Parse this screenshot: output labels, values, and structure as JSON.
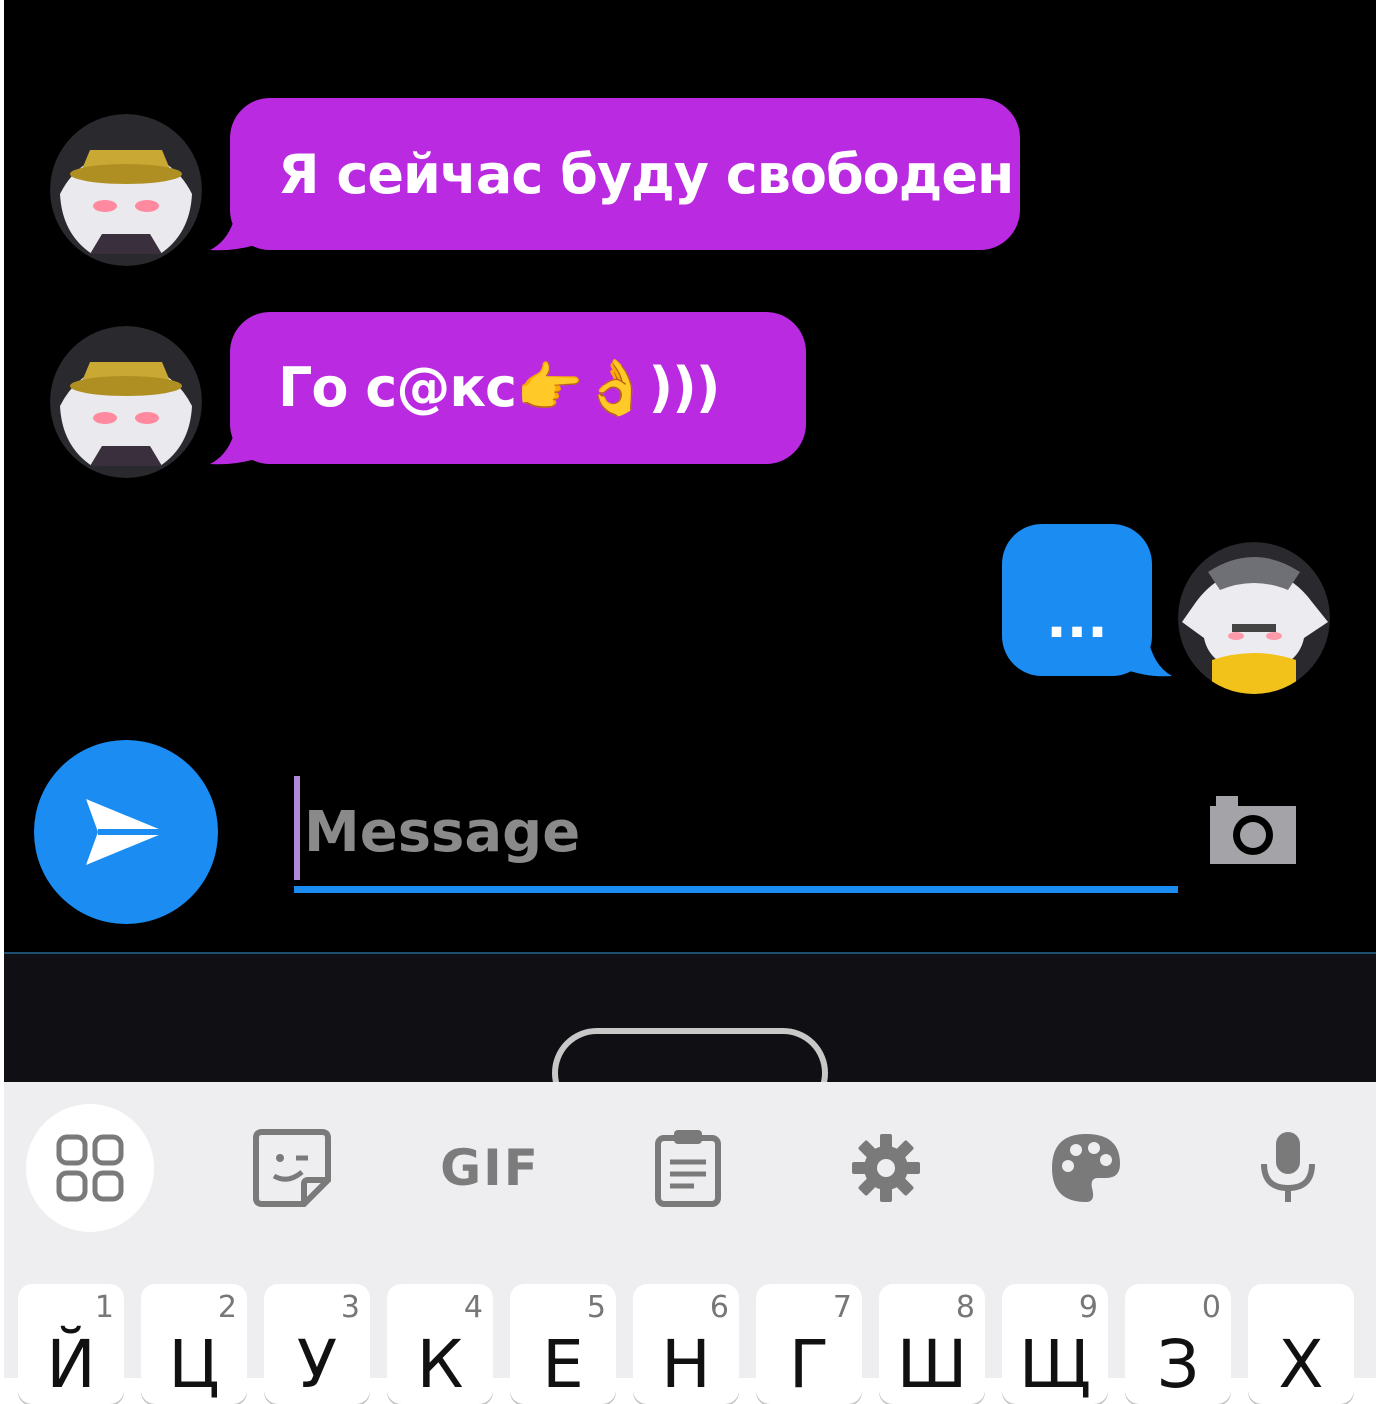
{
  "chat": {
    "messages": [
      {
        "direction": "incoming",
        "text": "Я сейчас буду свободен"
      },
      {
        "direction": "incoming",
        "text": "Го с@кс👉👌)))"
      },
      {
        "direction": "outgoing",
        "text": "..."
      }
    ]
  },
  "composer": {
    "placeholder": "Message",
    "send_icon": "send-icon",
    "camera_icon": "camera-icon"
  },
  "keyboard": {
    "toolbar": [
      {
        "name": "apps-grid-icon"
      },
      {
        "name": "sticker-icon"
      },
      {
        "name": "gif-button",
        "label": "GIF"
      },
      {
        "name": "clipboard-icon"
      },
      {
        "name": "settings-icon"
      },
      {
        "name": "palette-icon"
      },
      {
        "name": "microphone-icon"
      }
    ],
    "row1": [
      {
        "num": "1",
        "letter": "Й"
      },
      {
        "num": "2",
        "letter": "Ц"
      },
      {
        "num": "3",
        "letter": "У"
      },
      {
        "num": "4",
        "letter": "К"
      },
      {
        "num": "5",
        "letter": "Е"
      },
      {
        "num": "6",
        "letter": "Н"
      },
      {
        "num": "7",
        "letter": "Г"
      },
      {
        "num": "8",
        "letter": "Ш"
      },
      {
        "num": "9",
        "letter": "Щ"
      },
      {
        "num": "0",
        "letter": "З"
      },
      {
        "num": "",
        "letter": "Х"
      }
    ]
  },
  "colors": {
    "incoming_bubble": "#b92ae0",
    "outgoing_bubble": "#1a8cf2",
    "accent": "#1a8cf2",
    "background": "#000000",
    "keyboard_bg": "#eeedf0"
  }
}
